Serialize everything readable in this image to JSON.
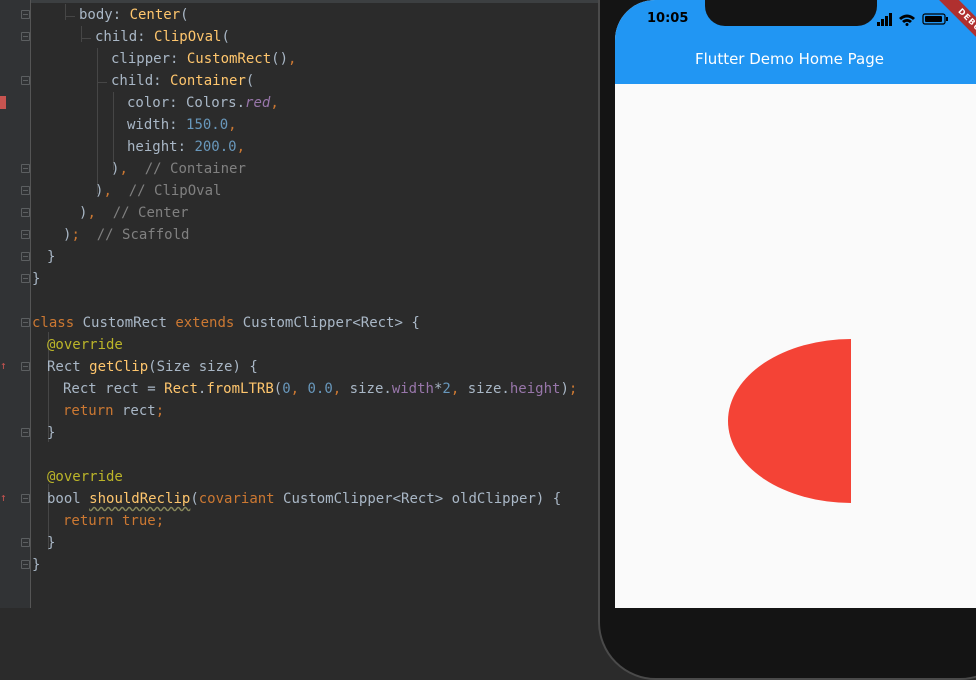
{
  "code": {
    "lines": [
      "body: Center(",
      "child: ClipOval(",
      "clipper: CustomRect(),",
      "child: Container(",
      "color: Colors.red,",
      "width: 150.0,",
      "height: 200.0,",
      "),  // Container",
      "),  // ClipOval",
      "),  // Center",
      ");  // Scaffold",
      "}",
      "}",
      "",
      "class CustomRect extends CustomClipper<Rect> {",
      "@override",
      "Rect getClip(Size size) {",
      "Rect rect = Rect.fromLTRB(0, 0.0, size.width*2, size.height);",
      "return rect;",
      "}",
      "",
      "@override",
      "bool shouldReclip(covariant CustomClipper<Rect> oldClipper) {",
      "return true;",
      "}",
      "}"
    ]
  },
  "phone": {
    "time": "10:05",
    "debug_banner": "DEBUG",
    "appbar_title": "Flutter Demo Home Page",
    "colors": {
      "appbar": "#2196f3",
      "shape": "#f44336",
      "background": "#fafafa"
    }
  }
}
